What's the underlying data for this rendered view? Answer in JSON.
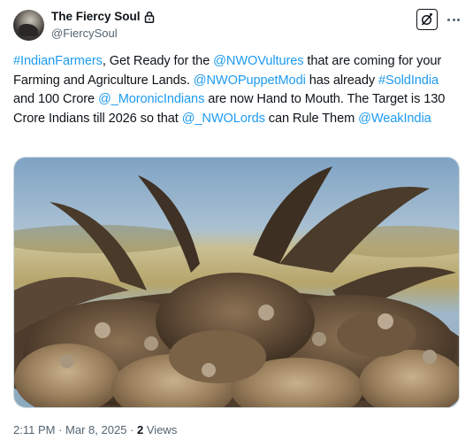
{
  "author": {
    "display_name": "The Fiercy Soul",
    "handle": "@FiercySoul"
  },
  "icons": {
    "avatar": "profile-photo",
    "lock": "lock-icon",
    "grok": "grok-icon",
    "more": "more-dots-icon"
  },
  "tweet": {
    "segments": [
      {
        "text": "#IndianFarmers",
        "type": "hashtag"
      },
      {
        "text": ", Get Ready for the ",
        "type": "text"
      },
      {
        "text": "@NWOVultures",
        "type": "mention"
      },
      {
        "text": " that are coming for your Farming and Agriculture Lands. ",
        "type": "text"
      },
      {
        "text": "@NWOPuppetModi",
        "type": "mention"
      },
      {
        "text": " has already ",
        "type": "text"
      },
      {
        "text": "#SoldIndia",
        "type": "hashtag"
      },
      {
        "text": " and 100 Crore ",
        "type": "text"
      },
      {
        "text": "@_MoronicIndians",
        "type": "mention"
      },
      {
        "text": " are now Hand to Mouth. The Target is 130 Crore Indians till 2026 so that ",
        "type": "text"
      },
      {
        "text": "@_NWOLords",
        "type": "mention"
      },
      {
        "text": " can Rule Them ",
        "type": "text"
      },
      {
        "text": "@WeakIndia",
        "type": "mention"
      }
    ]
  },
  "media": {
    "subject": "vultures-photo"
  },
  "meta": {
    "time": "2:11 PM",
    "separator": "·",
    "date": "Mar 8, 2025",
    "views_count": "2",
    "views_label": "Views"
  },
  "colors": {
    "link": "#1d9bf0",
    "text": "#0f1419",
    "secondary": "#536471",
    "border": "#cfd9de"
  }
}
